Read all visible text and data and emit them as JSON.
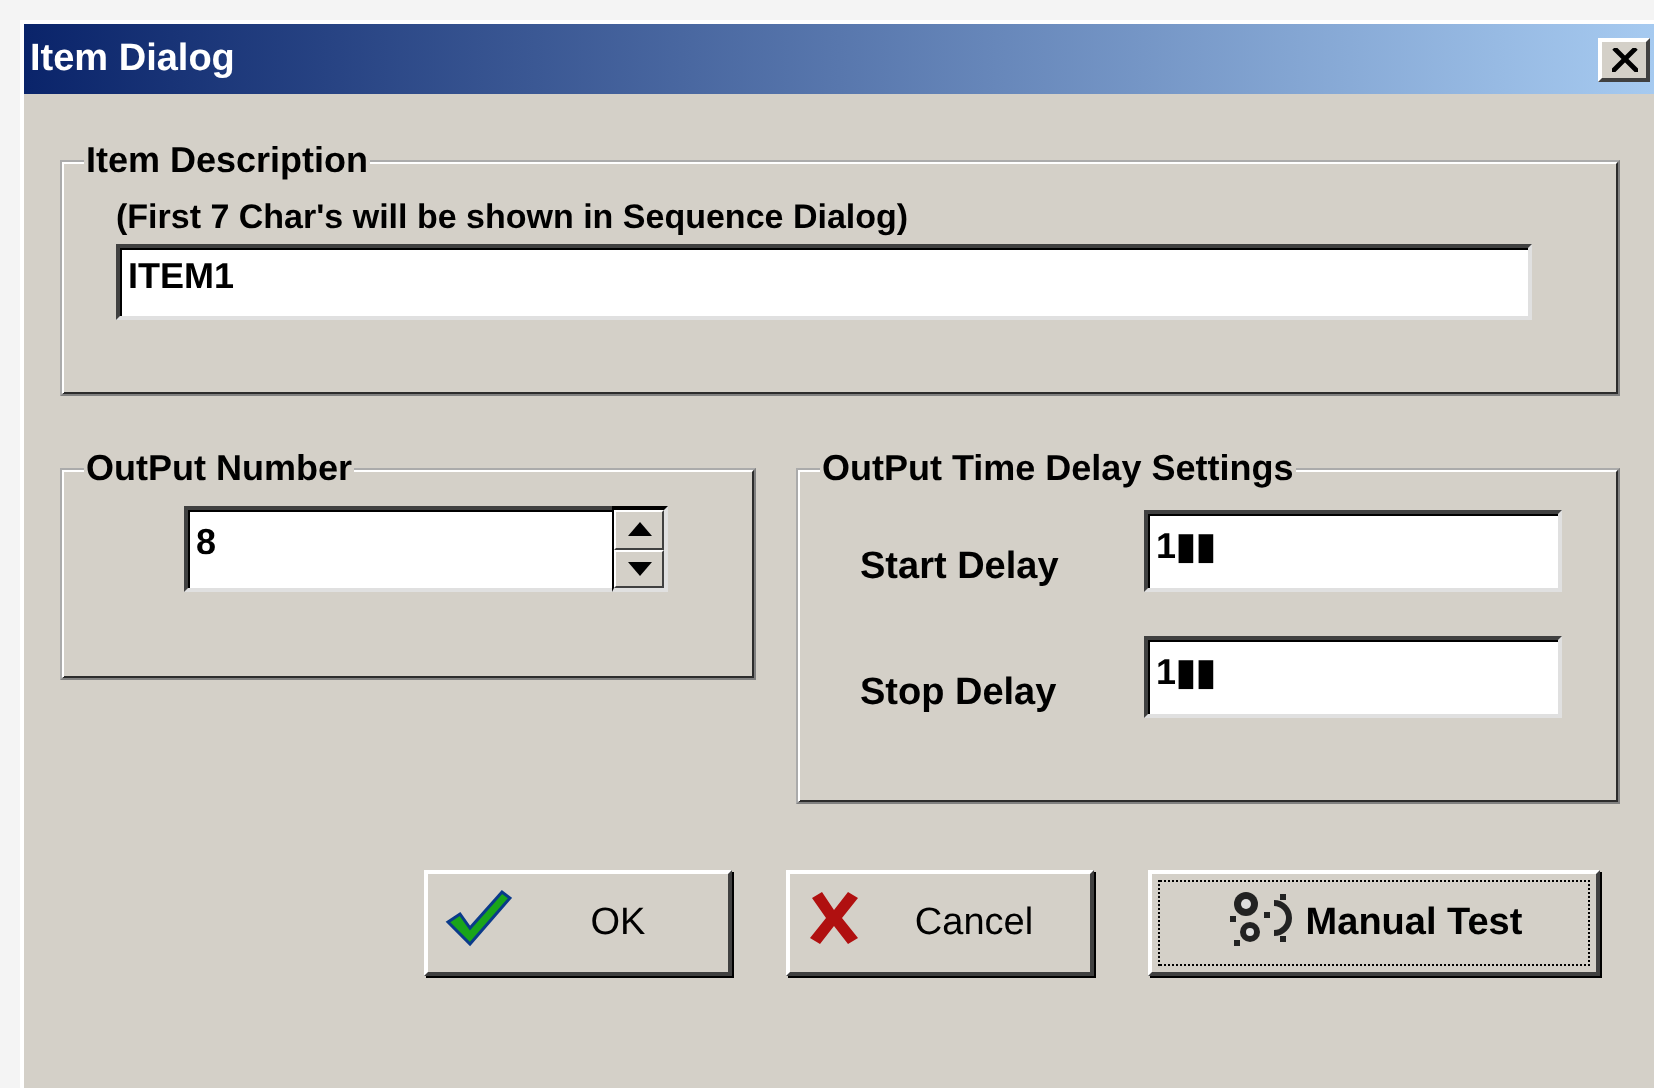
{
  "window": {
    "title": "Item Dialog"
  },
  "item_description": {
    "label": "Item Description",
    "hint": "(First 7 Char's will be shown in Sequence Dialog)",
    "value": "ITEM1"
  },
  "output_number": {
    "label": "OutPut Number",
    "value": "8"
  },
  "time_delay": {
    "label": "OutPut Time Delay Settings",
    "fields": [
      {
        "label": "Start Delay",
        "value": "1▮▮"
      },
      {
        "label": "Stop Delay",
        "value": "1▮▮"
      }
    ]
  },
  "buttons": [
    {
      "label": "OK",
      "kind": "ok",
      "focused": false
    },
    {
      "label": "Cancel",
      "kind": "cancel",
      "focused": false
    },
    {
      "label": "Manual Test",
      "kind": "test",
      "focused": true
    }
  ]
}
